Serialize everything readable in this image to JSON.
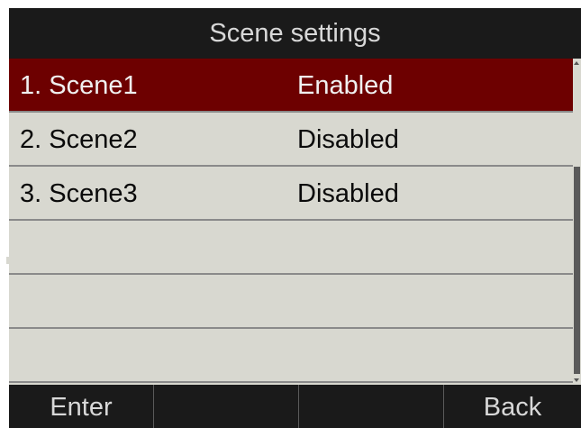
{
  "title": "Scene settings",
  "scenes": [
    {
      "name": "1. Scene1",
      "status": "Enabled",
      "selected": true
    },
    {
      "name": "2. Scene2",
      "status": "Disabled",
      "selected": false
    },
    {
      "name": "3. Scene3",
      "status": "Disabled",
      "selected": false
    }
  ],
  "softkeys": {
    "key1": "Enter",
    "key2": "",
    "key3": "",
    "key4": "Back"
  },
  "colors": {
    "background": "#1a1a1a",
    "list_background": "#d8d8d0",
    "selected_row": "#6d0000",
    "text_light": "#d8d8d8",
    "text_dark": "#0a0a0a"
  }
}
